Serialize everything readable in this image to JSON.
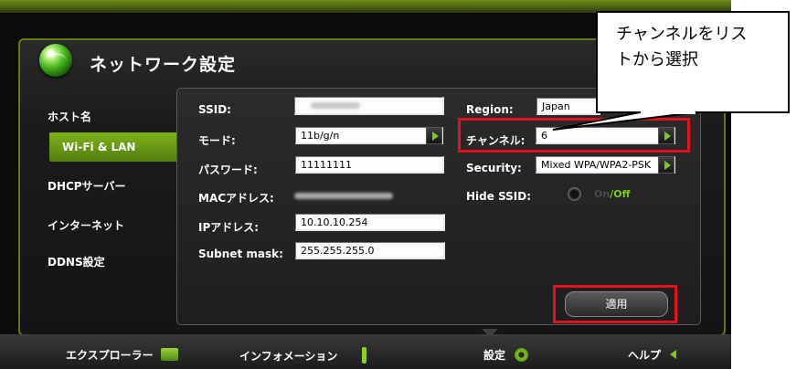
{
  "page": {
    "title": "ネットワーク設定"
  },
  "sidebar": {
    "items": [
      {
        "label": "ホスト名"
      },
      {
        "label": "Wi-Fi & LAN",
        "active": true
      },
      {
        "label": "DHCPサーバー"
      },
      {
        "label": "インターネット"
      },
      {
        "label": "DDNS設定"
      }
    ]
  },
  "form": {
    "ssid": {
      "label": "SSID:",
      "value": ""
    },
    "mode": {
      "label": "モード:",
      "value": "11b/g/n"
    },
    "password": {
      "label": "パスワード:",
      "value": "11111111"
    },
    "mac": {
      "label": "MACアドレス:",
      "value": ""
    },
    "ip": {
      "label": "IPアドレス:",
      "value": "10.10.10.254"
    },
    "subnet": {
      "label": "Subnet mask:",
      "value": "255.255.255.0"
    },
    "region": {
      "label": "Region:",
      "value": "Japan"
    },
    "channel": {
      "label": "チャンネル:",
      "value": "6"
    },
    "security": {
      "label": "Security:",
      "value": "Mixed WPA/WPA2-PSK"
    },
    "hide_ssid": {
      "label": "Hide SSID:",
      "on": "On",
      "sep": "/",
      "off": "Off"
    }
  },
  "apply_label": "適用",
  "bottom_nav": [
    {
      "label": "エクスプローラー"
    },
    {
      "label": "インフォメーション"
    },
    {
      "label": "設定"
    },
    {
      "label": "ヘルプ"
    }
  ],
  "callout": {
    "line1": "チャンネルをリス",
    "line2": "トから選択"
  },
  "colors": {
    "accent_green": "#7fb31b",
    "highlight_red": "#e1141c",
    "frame_green": "#5f7d10"
  }
}
